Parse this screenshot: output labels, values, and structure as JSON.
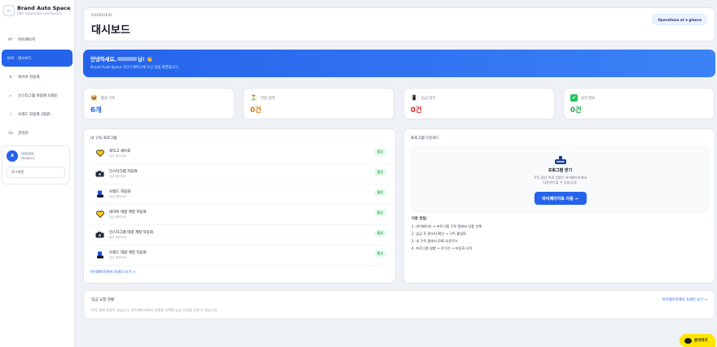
{
  "brand": {
    "logo_text": "B·I",
    "title": "Brand Auto Space",
    "subtitle": "SNS automation workspace"
  },
  "sidebar": {
    "items": [
      {
        "code": "MY",
        "label": "마이페이지"
      },
      {
        "code": "B·M",
        "label": "대시보드"
      },
      {
        "code": "N",
        "label": "네이버 자동화"
      },
      {
        "code": "▭",
        "label": "인스타그램 자동화 (대량)"
      },
      {
        "code": "♫",
        "label": "쓰레드 자동화 (대량)"
      },
      {
        "code": "AD",
        "label": "관리자"
      }
    ]
  },
  "user": {
    "avatar_letter": "A",
    "role": "마이페이지",
    "logout_label": "로그아웃"
  },
  "header": {
    "overview_label": "OVERVIEW",
    "title": "대시보드",
    "glance_button": "Operations at a glance"
  },
  "banner": {
    "greeting_prefix": "안녕하세요,",
    "greeting_suffix": "님! 👋",
    "subtitle": "Brand Auto Space 워크스페이스에 오신 것을 환영합니다."
  },
  "stats": [
    {
      "label": "활성 구독",
      "value": "6개",
      "icon": "📦",
      "color": "#2563eb",
      "icon_bg": "#fef3c7"
    },
    {
      "label": "전송 입력",
      "value": "0건",
      "icon": "⏳",
      "color": "#d97706",
      "icon_bg": "#fff7ed"
    },
    {
      "label": "입금 대기",
      "value": "0건",
      "icon": "📱",
      "color": "#dc2626",
      "icon_bg": "#f3f4f6"
    },
    {
      "label": "승인 완료",
      "value": "0건",
      "icon": "✔",
      "color": "#16a34a",
      "icon_bg": "#22c55e"
    }
  ],
  "programs": {
    "title": "내 구독 프로그램",
    "items": [
      {
        "name": "로또고 셰이후",
        "date": "입금 에이비씨",
        "badge": "활성",
        "icon": "heart-icon"
      },
      {
        "name": "인스타그램 자동화",
        "date": "입금 에이비씨",
        "badge": "활성",
        "icon": "camera-icon"
      },
      {
        "name": "쓰레드 자동화",
        "date": "입금 에이비씨",
        "badge": "활성",
        "icon": "thread-icon"
      },
      {
        "name": "네이버 대량 계정 자동화",
        "date": "입금 에이비씨",
        "badge": "활성",
        "icon": "heart-icon"
      },
      {
        "name": "인스타그램 대량 계정 자동화",
        "date": "입금 에이비씨",
        "badge": "활성",
        "icon": "camera-icon"
      },
      {
        "name": "쓰레드 대량 계정 자동화",
        "date": "입금 에이비씨",
        "badge": "활성",
        "icon": "thread-icon"
      }
    ],
    "more_link": "마이페이지에서 자세히 보기 →"
  },
  "download": {
    "title": "프로그램 다운로드",
    "box_title": "프로그램 받기",
    "box_desc_1": "구독 중인 프로그램은 마이페이지에서",
    "box_desc_2": "다운로드할 수 있습니다.",
    "button": "마이페이지로 이동 →",
    "howto_title": "이용 방법:",
    "steps": [
      "1. 마이페이지 → 프로그램 구독 탭에서 상품 선택",
      "2. 입금 후 관리자 확인 → 구독 활성화",
      "3. 내 구독 탭에서 EXE 다운로드",
      "4. 프로그램 실행 → 로그인 → 자동화 시작"
    ]
  },
  "requests": {
    "title": "입금 요청 현황",
    "link": "마이페이지에서 자세히 보기 →",
    "empty": "아직 결제 요청이 없습니다. 마이페이지에서 상품을 선택해 입금 요청을 진행 수 있습니다."
  },
  "kakao": {
    "label": "문의하기"
  },
  "colors": {
    "accent": "#2563eb",
    "badge_green": "#15803d",
    "kakao_yellow": "#fee500"
  }
}
